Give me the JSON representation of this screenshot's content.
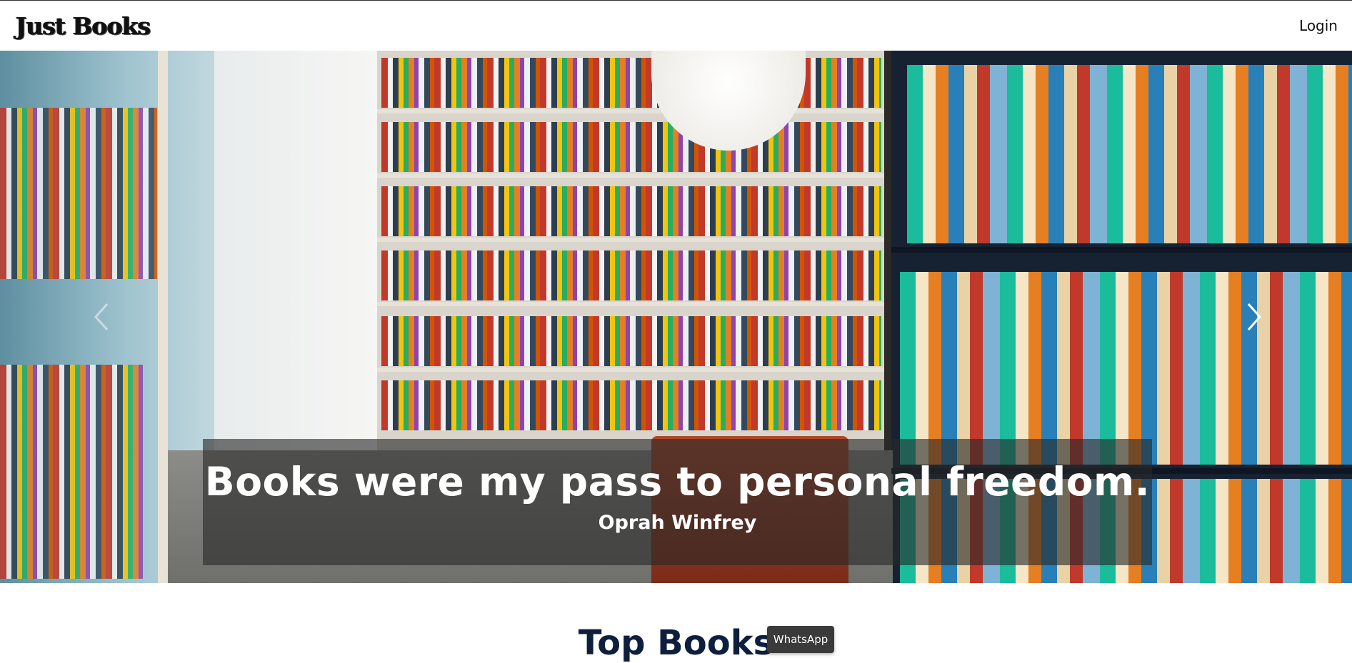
{
  "navbar": {
    "logo_text": "Just Books",
    "login_label": "Login"
  },
  "hero": {
    "quote": "Books were my pass to personal freedom.",
    "author": "Oprah Winfrey",
    "prev_icon": "chevron-left-icon",
    "next_icon": "chevron-right-icon"
  },
  "section": {
    "title": "Top Books"
  },
  "whatsapp": {
    "label": "WhatsApp"
  }
}
